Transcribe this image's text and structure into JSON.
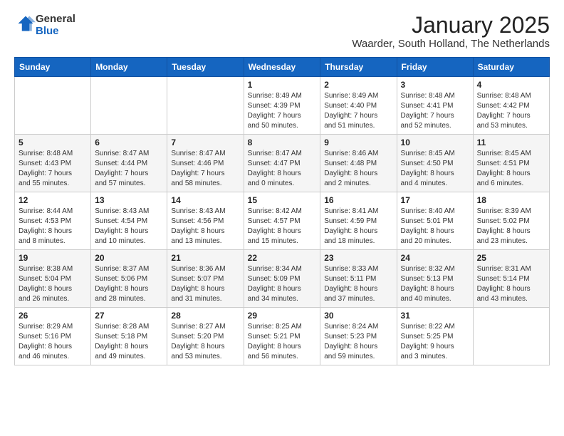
{
  "header": {
    "logo_general": "General",
    "logo_blue": "Blue",
    "month_title": "January 2025",
    "location": "Waarder, South Holland, The Netherlands"
  },
  "weekdays": [
    "Sunday",
    "Monday",
    "Tuesday",
    "Wednesday",
    "Thursday",
    "Friday",
    "Saturday"
  ],
  "weeks": [
    [
      {
        "day": "",
        "detail": ""
      },
      {
        "day": "",
        "detail": ""
      },
      {
        "day": "",
        "detail": ""
      },
      {
        "day": "1",
        "detail": "Sunrise: 8:49 AM\nSunset: 4:39 PM\nDaylight: 7 hours\nand 50 minutes."
      },
      {
        "day": "2",
        "detail": "Sunrise: 8:49 AM\nSunset: 4:40 PM\nDaylight: 7 hours\nand 51 minutes."
      },
      {
        "day": "3",
        "detail": "Sunrise: 8:48 AM\nSunset: 4:41 PM\nDaylight: 7 hours\nand 52 minutes."
      },
      {
        "day": "4",
        "detail": "Sunrise: 8:48 AM\nSunset: 4:42 PM\nDaylight: 7 hours\nand 53 minutes."
      }
    ],
    [
      {
        "day": "5",
        "detail": "Sunrise: 8:48 AM\nSunset: 4:43 PM\nDaylight: 7 hours\nand 55 minutes."
      },
      {
        "day": "6",
        "detail": "Sunrise: 8:47 AM\nSunset: 4:44 PM\nDaylight: 7 hours\nand 57 minutes."
      },
      {
        "day": "7",
        "detail": "Sunrise: 8:47 AM\nSunset: 4:46 PM\nDaylight: 7 hours\nand 58 minutes."
      },
      {
        "day": "8",
        "detail": "Sunrise: 8:47 AM\nSunset: 4:47 PM\nDaylight: 8 hours\nand 0 minutes."
      },
      {
        "day": "9",
        "detail": "Sunrise: 8:46 AM\nSunset: 4:48 PM\nDaylight: 8 hours\nand 2 minutes."
      },
      {
        "day": "10",
        "detail": "Sunrise: 8:45 AM\nSunset: 4:50 PM\nDaylight: 8 hours\nand 4 minutes."
      },
      {
        "day": "11",
        "detail": "Sunrise: 8:45 AM\nSunset: 4:51 PM\nDaylight: 8 hours\nand 6 minutes."
      }
    ],
    [
      {
        "day": "12",
        "detail": "Sunrise: 8:44 AM\nSunset: 4:53 PM\nDaylight: 8 hours\nand 8 minutes."
      },
      {
        "day": "13",
        "detail": "Sunrise: 8:43 AM\nSunset: 4:54 PM\nDaylight: 8 hours\nand 10 minutes."
      },
      {
        "day": "14",
        "detail": "Sunrise: 8:43 AM\nSunset: 4:56 PM\nDaylight: 8 hours\nand 13 minutes."
      },
      {
        "day": "15",
        "detail": "Sunrise: 8:42 AM\nSunset: 4:57 PM\nDaylight: 8 hours\nand 15 minutes."
      },
      {
        "day": "16",
        "detail": "Sunrise: 8:41 AM\nSunset: 4:59 PM\nDaylight: 8 hours\nand 18 minutes."
      },
      {
        "day": "17",
        "detail": "Sunrise: 8:40 AM\nSunset: 5:01 PM\nDaylight: 8 hours\nand 20 minutes."
      },
      {
        "day": "18",
        "detail": "Sunrise: 8:39 AM\nSunset: 5:02 PM\nDaylight: 8 hours\nand 23 minutes."
      }
    ],
    [
      {
        "day": "19",
        "detail": "Sunrise: 8:38 AM\nSunset: 5:04 PM\nDaylight: 8 hours\nand 26 minutes."
      },
      {
        "day": "20",
        "detail": "Sunrise: 8:37 AM\nSunset: 5:06 PM\nDaylight: 8 hours\nand 28 minutes."
      },
      {
        "day": "21",
        "detail": "Sunrise: 8:36 AM\nSunset: 5:07 PM\nDaylight: 8 hours\nand 31 minutes."
      },
      {
        "day": "22",
        "detail": "Sunrise: 8:34 AM\nSunset: 5:09 PM\nDaylight: 8 hours\nand 34 minutes."
      },
      {
        "day": "23",
        "detail": "Sunrise: 8:33 AM\nSunset: 5:11 PM\nDaylight: 8 hours\nand 37 minutes."
      },
      {
        "day": "24",
        "detail": "Sunrise: 8:32 AM\nSunset: 5:13 PM\nDaylight: 8 hours\nand 40 minutes."
      },
      {
        "day": "25",
        "detail": "Sunrise: 8:31 AM\nSunset: 5:14 PM\nDaylight: 8 hours\nand 43 minutes."
      }
    ],
    [
      {
        "day": "26",
        "detail": "Sunrise: 8:29 AM\nSunset: 5:16 PM\nDaylight: 8 hours\nand 46 minutes."
      },
      {
        "day": "27",
        "detail": "Sunrise: 8:28 AM\nSunset: 5:18 PM\nDaylight: 8 hours\nand 49 minutes."
      },
      {
        "day": "28",
        "detail": "Sunrise: 8:27 AM\nSunset: 5:20 PM\nDaylight: 8 hours\nand 53 minutes."
      },
      {
        "day": "29",
        "detail": "Sunrise: 8:25 AM\nSunset: 5:21 PM\nDaylight: 8 hours\nand 56 minutes."
      },
      {
        "day": "30",
        "detail": "Sunrise: 8:24 AM\nSunset: 5:23 PM\nDaylight: 8 hours\nand 59 minutes."
      },
      {
        "day": "31",
        "detail": "Sunrise: 8:22 AM\nSunset: 5:25 PM\nDaylight: 9 hours\nand 3 minutes."
      },
      {
        "day": "",
        "detail": ""
      }
    ]
  ]
}
